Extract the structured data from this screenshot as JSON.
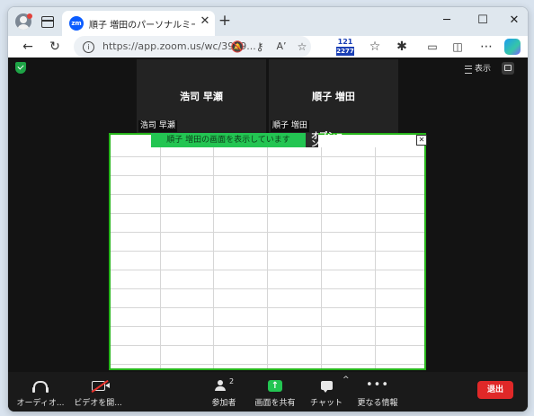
{
  "browser": {
    "tab": {
      "favicon": "zm",
      "title": "順子 増田のパーソナルミーティングルー",
      "close": "✕"
    },
    "new_tab": "+",
    "window_controls": {
      "minimize": "─",
      "maximize": "☐",
      "close": "✕"
    },
    "address_bar": {
      "url": "https://app.zoom.us/wc/3909..."
    },
    "extension_badge": {
      "top": "121",
      "bottom": "2277"
    },
    "toolbar_icons": [
      "back-icon",
      "refresh-icon",
      "info-icon",
      "notifications-off-icon",
      "key-icon",
      "read-aloud-icon",
      "favorite-icon",
      "extensions-icon",
      "favorites-icon",
      "cast-icon",
      "split-screen-icon",
      "more-icon",
      "copilot-icon"
    ]
  },
  "meeting": {
    "view_button": "表示",
    "tiles": [
      {
        "name": "浩司 早瀬",
        "label": "浩司 早瀬"
      },
      {
        "name": "順子 増田",
        "label": "順子 増田"
      }
    ],
    "share": {
      "status": "順子 増田の画面を表示しています",
      "options_line1": "オプションを表",
      "options_line2": "示",
      "close": "✕"
    },
    "controls": {
      "audio": "オーディオ...",
      "video": "ビデオを開...",
      "participants": "参加者",
      "participants_count": "2",
      "share": "画面を共有",
      "chat": "チャット",
      "more": "更なる情報",
      "leave": "退出"
    }
  },
  "colors": {
    "share_border": "#26b51a",
    "share_status_bg": "#23c552",
    "leave_bg": "#e02828",
    "meeting_bg": "#131313",
    "shield": "#1ea446"
  }
}
